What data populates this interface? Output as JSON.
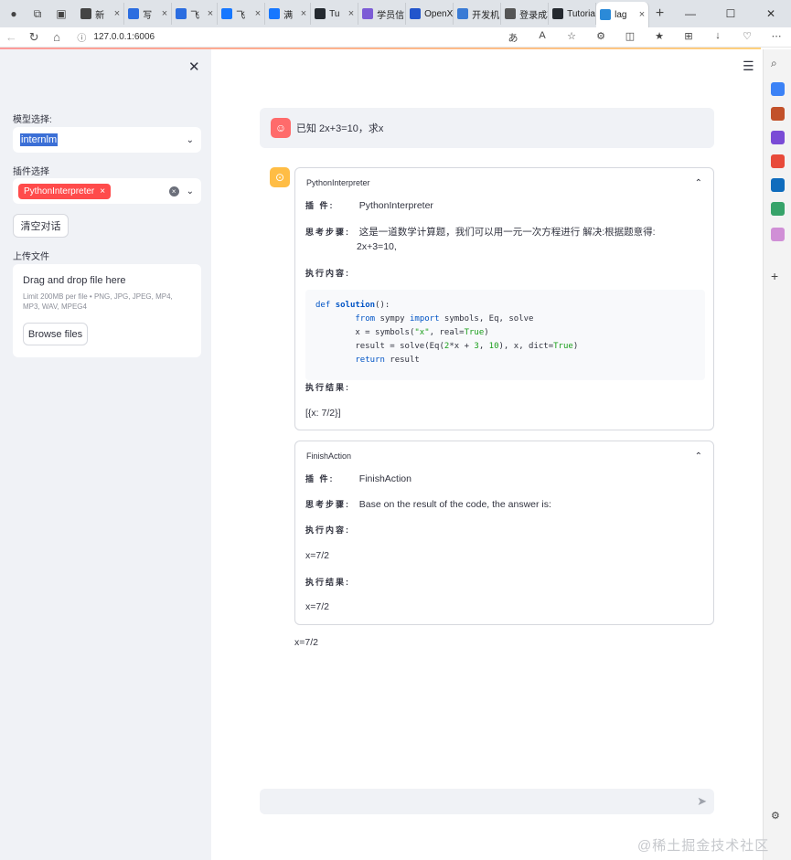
{
  "browser": {
    "tabs": [
      {
        "label": "新",
        "color": "#444"
      },
      {
        "label": "写",
        "color": "#2b6de0"
      },
      {
        "label": "飞",
        "color": "#2b6de0"
      },
      {
        "label": "飞",
        "color": "#1677ff"
      },
      {
        "label": "满",
        "color": "#1677ff"
      },
      {
        "label": "Tu",
        "color": "#24292f"
      },
      {
        "label": "学员信!",
        "color": "#7c5cd6"
      },
      {
        "label": "OpenXL",
        "color": "#2255cc"
      },
      {
        "label": "开发机",
        "color": "#3a7bd5"
      },
      {
        "label": "登录成功",
        "color": "#555"
      },
      {
        "label": "Tutorial",
        "color": "#24292f"
      },
      {
        "label": "lag",
        "color": "#2b8ad8"
      }
    ],
    "url": "127.0.0.1:6006",
    "window_controls": [
      "—",
      "☐",
      "✕"
    ]
  },
  "sidebar": {
    "model_label": "模型选择:",
    "model_value": "internlm",
    "plugin_label": "插件选择",
    "plugin_chip": "PythonInterpreter",
    "clear_button": "清空对话",
    "upload_label": "上传文件",
    "upload_title": "Drag and drop file here",
    "upload_hint": "Limit 200MB per file • PNG, JPG, JPEG, MP4, MP3, WAV, MPEG4",
    "browse_button": "Browse files"
  },
  "chat": {
    "user_message": "已知 2x+3=10，求x",
    "step1": {
      "title": "PythonInterpreter",
      "plugin_key": "插 件:",
      "plugin_val": "PythonInterpreter",
      "thought_key": "思考步骤:",
      "thought_val_1": "这是一道数学计算题，我们可以用一元一次方程进行 解决:根据题意得:",
      "thought_val_2": "2x+3=10,",
      "exec_key": "执行内容:",
      "result_key": "执行结果:",
      "result_val": "[{x: 7/2}]"
    },
    "step2": {
      "title": "FinishAction",
      "plugin_key": "插 件:",
      "plugin_val": "FinishAction",
      "thought_key": "思考步骤:",
      "thought_val": "Base on the result of the code, the answer is:",
      "exec_key": "执行内容:",
      "exec_val": "x=7/2",
      "result_key": "执行结果:",
      "result_val": "x=7/2"
    },
    "final_answer": "x=7/2"
  },
  "watermark": "@稀土掘金技术社区",
  "colors": {
    "accent": "#ff4b4b",
    "sidebar_bg": "#f0f2f6",
    "bot_avatar": "#ffbd45",
    "user_avatar": "#ff6b6b"
  }
}
